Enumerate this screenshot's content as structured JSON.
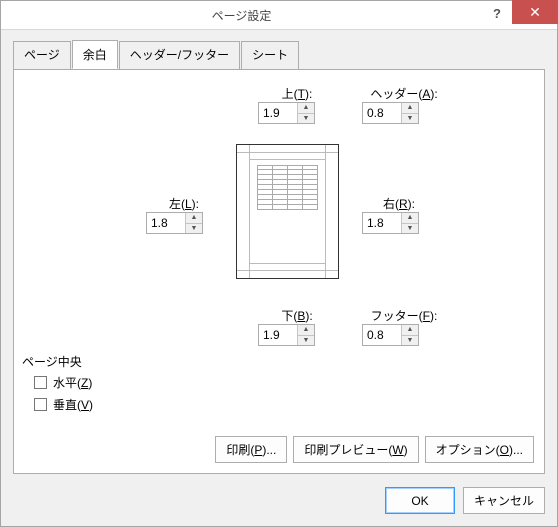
{
  "window": {
    "title": "ページ設定"
  },
  "tabs": [
    {
      "label": "ページ"
    },
    {
      "label": "余白"
    },
    {
      "label": "ヘッダー/フッター"
    },
    {
      "label": "シート"
    }
  ],
  "margins": {
    "top": {
      "label_pre": "上(",
      "key": "T",
      "label_post": "):",
      "value": "1.9"
    },
    "header": {
      "label_pre": "ヘッダー(",
      "key": "A",
      "label_post": "):",
      "value": "0.8"
    },
    "left": {
      "label_pre": "左(",
      "key": "L",
      "label_post": "):",
      "value": "1.8"
    },
    "right": {
      "label_pre": "右(",
      "key": "R",
      "label_post": "):",
      "value": "1.8"
    },
    "bottom": {
      "label_pre": "下(",
      "key": "B",
      "label_post": "):",
      "value": "1.9"
    },
    "footer": {
      "label_pre": "フッター(",
      "key": "F",
      "label_post": "):",
      "value": "0.8"
    }
  },
  "center_group": {
    "title": "ページ中央",
    "horizontal": {
      "pre": "水平(",
      "key": "Z",
      "post": ")"
    },
    "vertical": {
      "pre": "垂直(",
      "key": "V",
      "post": ")"
    }
  },
  "actions": {
    "print": {
      "pre": "印刷(",
      "key": "P",
      "post": ")..."
    },
    "preview": {
      "pre": "印刷プレビュー(",
      "key": "W",
      "post": ")"
    },
    "options": {
      "pre": "オプション(",
      "key": "O",
      "post": ")..."
    }
  },
  "footer_buttons": {
    "ok": "OK",
    "cancel": "キャンセル"
  },
  "titlebar_icons": {
    "help": "?",
    "close": "✕"
  }
}
